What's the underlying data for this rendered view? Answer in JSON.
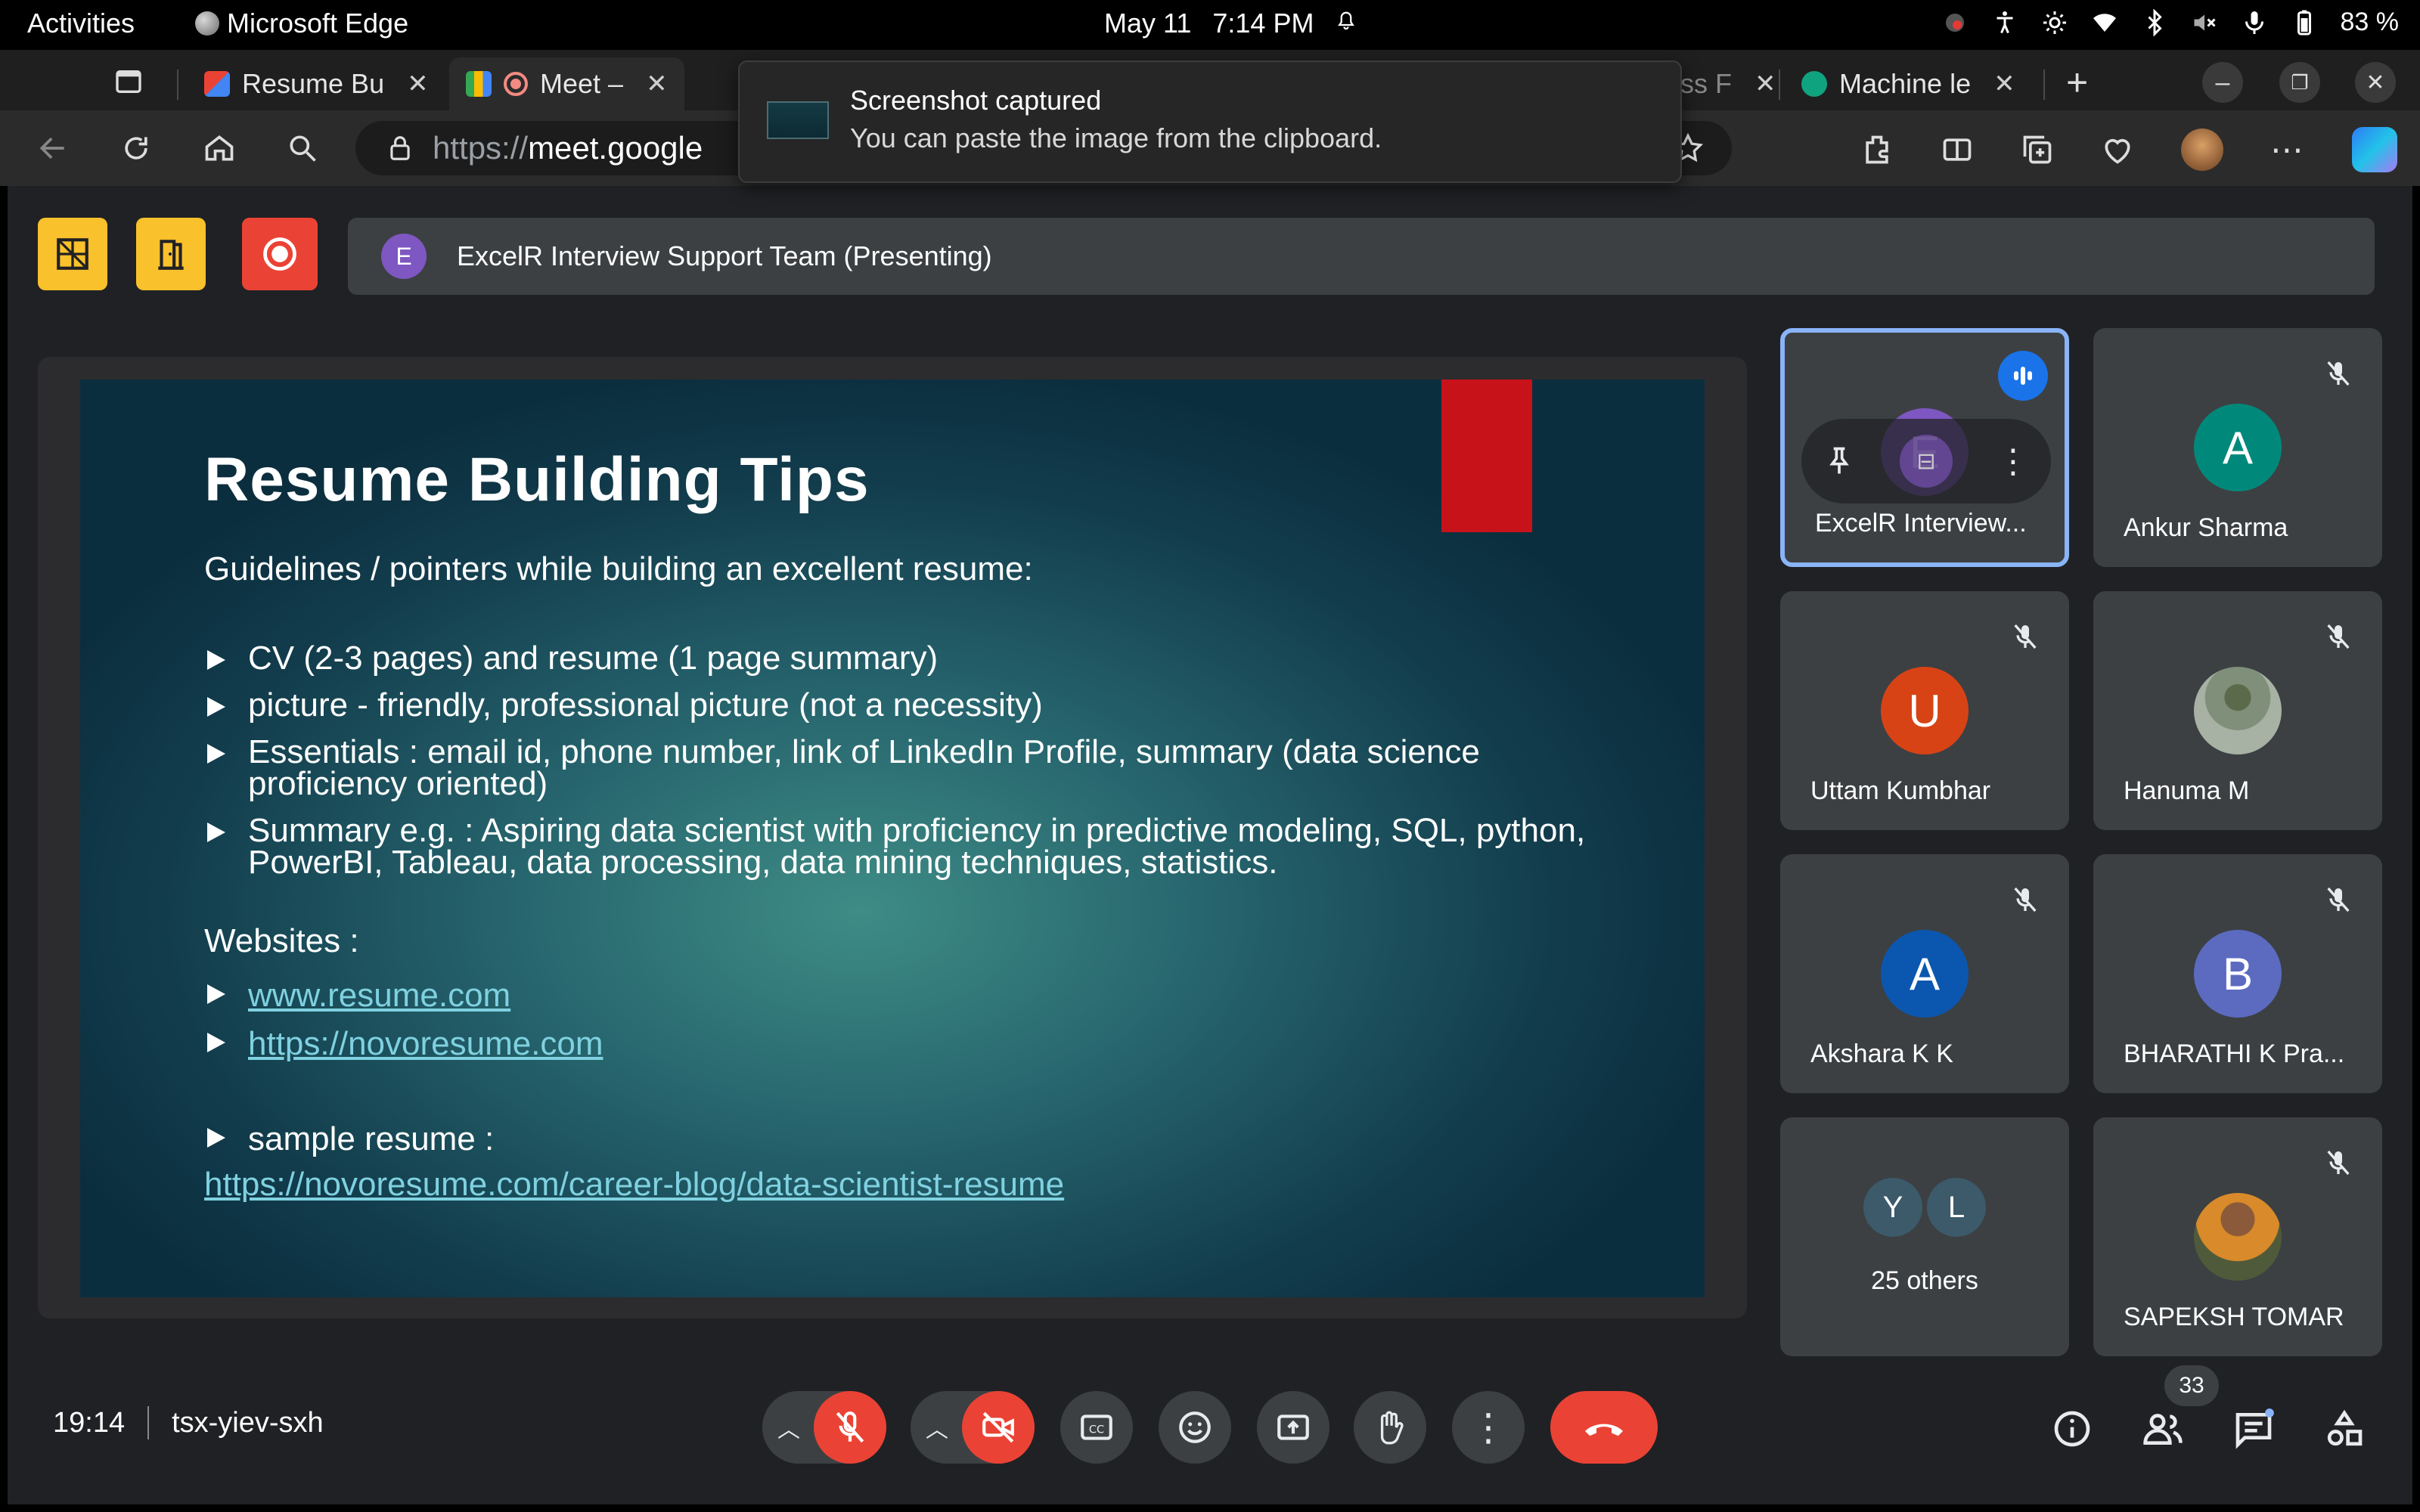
{
  "gnome": {
    "activities": "Activities",
    "app_name": "Microsoft Edge",
    "date": "May 11",
    "time": "7:14 PM",
    "battery": "83 %"
  },
  "tabs": [
    {
      "label": "Resume Bu",
      "favicon": "gmail-icon"
    },
    {
      "label": "Meet –",
      "favicon": "meet-icon",
      "active": true
    },
    {
      "label": "ss F",
      "favicon": "generic"
    },
    {
      "label": "Machine le",
      "favicon": "chatgpt-icon"
    }
  ],
  "address": {
    "scheme": "https://",
    "host": "meet.google"
  },
  "toast": {
    "title": "Screenshot captured",
    "body": "You can paste the image from the clipboard."
  },
  "presenter": {
    "initial": "E",
    "label": "ExcelR Interview Support Team (Presenting)"
  },
  "slide": {
    "title": "Resume Building Tips",
    "subtitle": "Guidelines / pointers while building an excellent resume:",
    "bullets": [
      "CV (2-3 pages) and resume (1 page summary)",
      "picture - friendly, professional picture (not a necessity)",
      "Essentials : email id, phone number, link of LinkedIn Profile, summary (data science proficiency oriented)",
      "Summary e.g. : Aspiring data scientist with proficiency in predictive modeling, SQL, python, PowerBI, Tableau, data processing, data mining techniques, statistics."
    ],
    "websites_label": "Websites :",
    "websites": [
      "www.resume.com",
      "https://novoresume.com"
    ],
    "sample_label": "sample resume :",
    "sample_url": "https://novoresume.com/career-blog/data-scientist-resume"
  },
  "participants": [
    {
      "name": "ExcelR Interview...",
      "initial": "E",
      "color": "#7e57c2",
      "speaking": true
    },
    {
      "name": "Ankur Sharma",
      "initial": "A",
      "color": "#00897b"
    },
    {
      "name": "Uttam Kumbhar",
      "initial": "U",
      "color": "#d84315"
    },
    {
      "name": "Hanuma M",
      "initial": "",
      "color": "#8d9a8a",
      "photo": true
    },
    {
      "name": "Akshara K K",
      "initial": "A",
      "color": "#0b57b0"
    },
    {
      "name": "BHARATHI K Pra...",
      "initial": "B",
      "color": "#5c6bc0"
    },
    {
      "name": "25 others",
      "initial_1": "Y",
      "initial_2": "L"
    },
    {
      "name": "SAPEKSH TOMAR",
      "initial": "",
      "color": "#c77a2a",
      "photo": true
    }
  ],
  "meeting": {
    "time": "19:14",
    "code": "tsx-yiev-sxh",
    "people_count": "33"
  }
}
